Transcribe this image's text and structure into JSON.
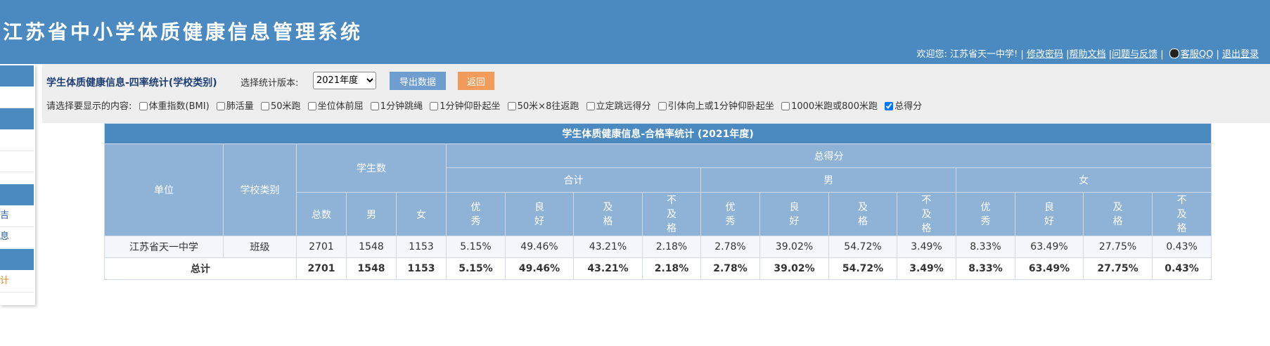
{
  "header": {
    "title": "江苏省中小学体质健康信息管理系统",
    "welcome": "欢迎您: 江苏省天一中学! |",
    "links": [
      "修改密码",
      "帮助文档",
      "问题与反馈",
      "客服QQ",
      "退出登录"
    ],
    "sep": "|"
  },
  "sidebar": {
    "items": [
      "吉",
      "息",
      "计"
    ]
  },
  "toolbar": {
    "page_title": "学生体质健康信息-四率统计(学校类别)",
    "version_label": "选择统计版本:",
    "version_value": "2021年度",
    "export_label": "导出数据",
    "back_label": "返回",
    "choose_label": "请选择要显示的内容:",
    "options": [
      {
        "label": "体重指数(BMI)",
        "checked": false
      },
      {
        "label": "肺活量",
        "checked": false
      },
      {
        "label": "50米跑",
        "checked": false
      },
      {
        "label": "坐位体前屈",
        "checked": false
      },
      {
        "label": "1分钟跳绳",
        "checked": false
      },
      {
        "label": "1分钟仰卧起坐",
        "checked": false
      },
      {
        "label": "50米×8往返跑",
        "checked": false
      },
      {
        "label": "立定跳远得分",
        "checked": false
      },
      {
        "label": "引体向上或1分钟仰卧起坐",
        "checked": false
      },
      {
        "label": "1000米跑或800米跑",
        "checked": false
      },
      {
        "label": "总得分",
        "checked": true
      }
    ]
  },
  "table": {
    "title": "学生体质健康信息-合格率统计 (2021年度)",
    "col_unit": "单位",
    "col_type": "学校类别",
    "col_students": "学生数",
    "col_total_score": "总得分",
    "group_all": "合计",
    "group_male": "男",
    "group_female": "女",
    "sub_total": "总数",
    "sub_male": "男",
    "sub_female": "女",
    "grades": [
      "优\n秀",
      "良\n好",
      "及\n格",
      "不\n及\n格"
    ],
    "rows": [
      {
        "unit": "江苏省天一中学",
        "type": "班级",
        "total": "2701",
        "male": "1548",
        "female": "1153",
        "values": [
          "5.15%",
          "49.46%",
          "43.21%",
          "2.18%",
          "2.78%",
          "39.02%",
          "54.72%",
          "3.49%",
          "8.33%",
          "63.49%",
          "27.75%",
          "0.43%"
        ]
      }
    ],
    "total_row": {
      "label": "总计",
      "total": "2701",
      "male": "1548",
      "female": "1153",
      "values": [
        "5.15%",
        "49.46%",
        "43.21%",
        "2.18%",
        "2.78%",
        "39.02%",
        "54.72%",
        "3.49%",
        "8.33%",
        "63.49%",
        "27.75%",
        "0.43%"
      ]
    }
  }
}
